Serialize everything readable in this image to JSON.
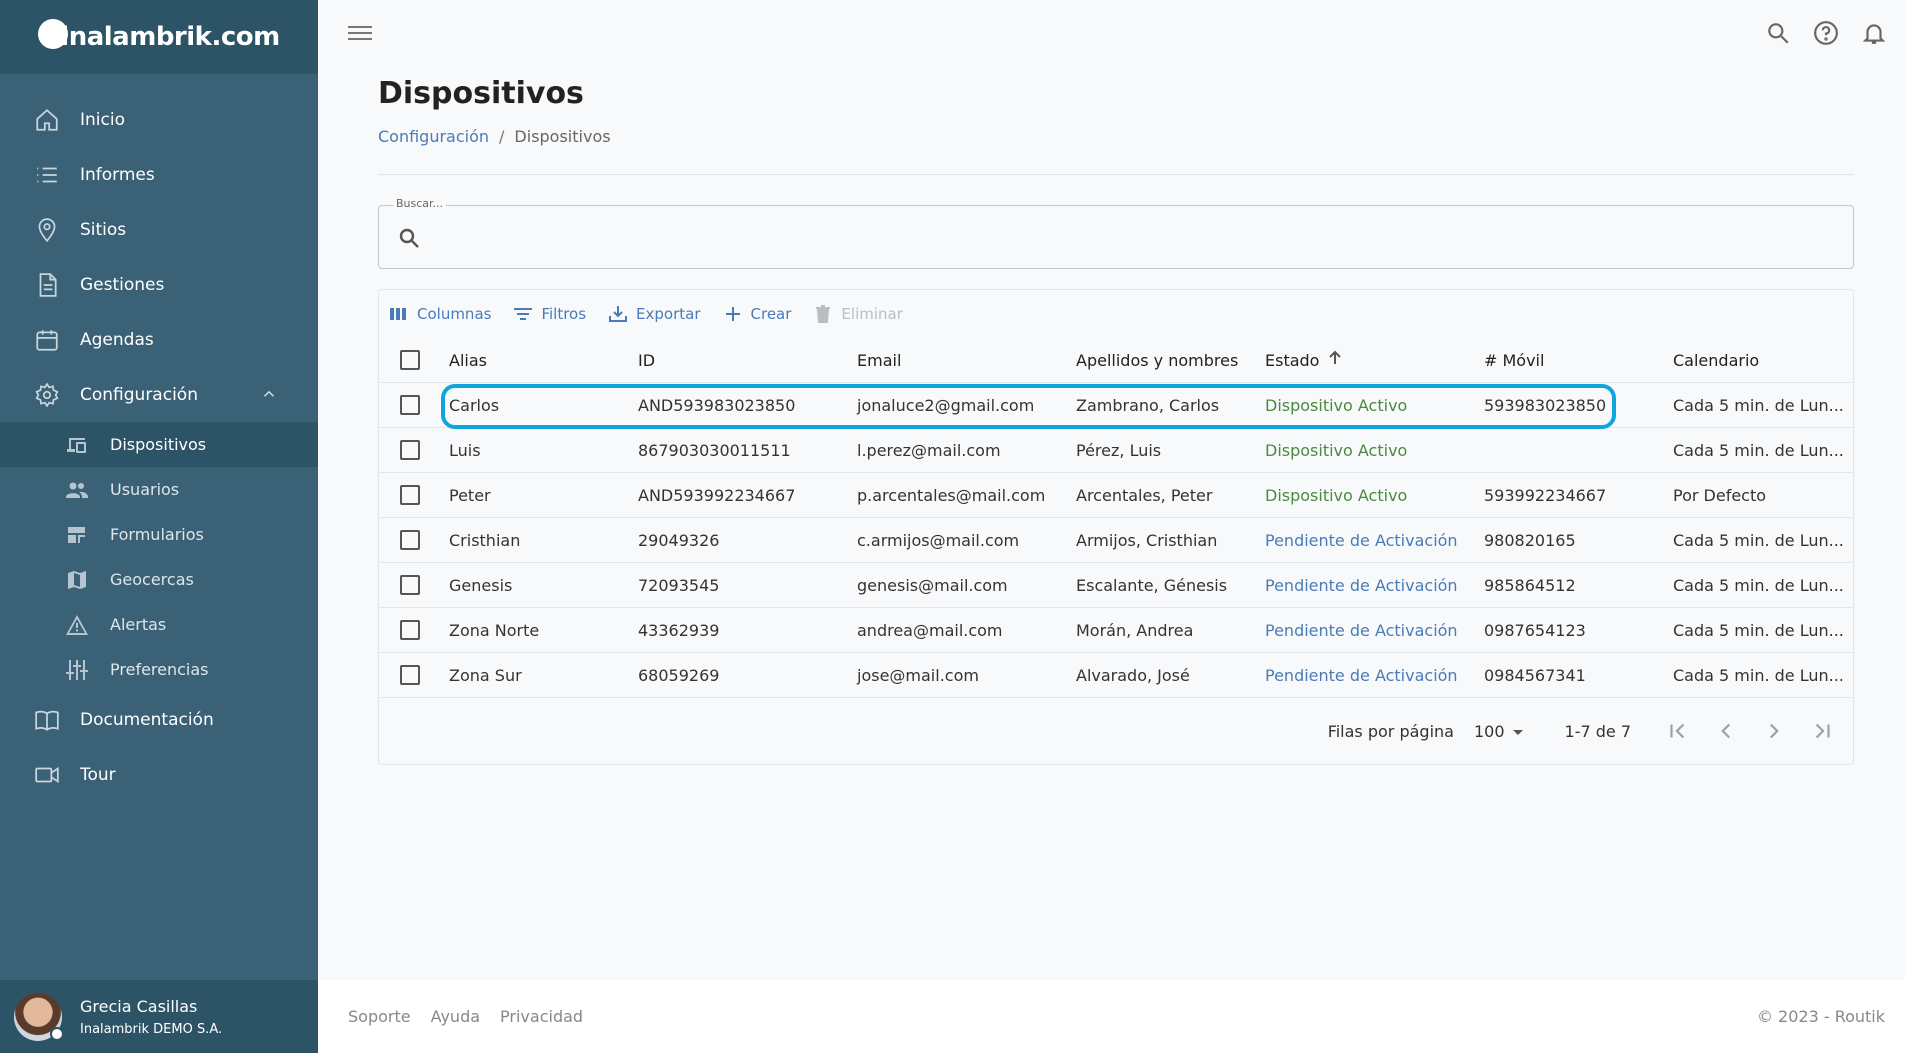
{
  "brand": {
    "logo_text": "inalambrik.com"
  },
  "sidebar": {
    "items": [
      {
        "label": "Inicio",
        "icon": "home-icon"
      },
      {
        "label": "Informes",
        "icon": "list-icon"
      },
      {
        "label": "Sitios",
        "icon": "map-pin-icon"
      },
      {
        "label": "Gestiones",
        "icon": "document-icon"
      },
      {
        "label": "Agendas",
        "icon": "calendar-icon"
      },
      {
        "label": "Configuración",
        "icon": "gear-icon"
      }
    ],
    "sub_items": [
      {
        "label": "Dispositivos",
        "icon": "devices-icon"
      },
      {
        "label": "Usuarios",
        "icon": "users-icon"
      },
      {
        "label": "Formularios",
        "icon": "forms-icon"
      },
      {
        "label": "Geocercas",
        "icon": "map-icon"
      },
      {
        "label": "Alertas",
        "icon": "warning-icon"
      },
      {
        "label": "Preferencias",
        "icon": "sliders-icon"
      }
    ],
    "bottom_items": [
      {
        "label": "Documentación",
        "icon": "book-icon"
      },
      {
        "label": "Tour",
        "icon": "video-icon"
      }
    ],
    "user": {
      "name": "Grecia Casillas",
      "org": "Inalambrik DEMO S.A."
    }
  },
  "page": {
    "title": "Dispositivos",
    "breadcrumb": {
      "parent": "Configuración",
      "separator": "/",
      "current": "Dispositivos"
    }
  },
  "search": {
    "label": "Buscar..."
  },
  "toolbar": {
    "columns": "Columnas",
    "filters": "Filtros",
    "export": "Exportar",
    "create": "Crear",
    "delete": "Eliminar"
  },
  "table": {
    "headers": [
      "Alias",
      "ID",
      "Email",
      "Apellidos y nombres",
      "Estado",
      "# Móvil",
      "Calendario"
    ],
    "rows": [
      {
        "alias": "Carlos",
        "id": "AND593983023850",
        "email": "jonaluce2@gmail.com",
        "name": "Zambrano, Carlos",
        "estado": "Dispositivo Activo",
        "movil": "593983023850",
        "cal": "Cada 5 min. de Lun..."
      },
      {
        "alias": "Luis",
        "id": "867903030011511",
        "email": "l.perez@mail.com",
        "name": "Pérez, Luis",
        "estado": "Dispositivo Activo",
        "movil": "",
        "cal": "Cada 5 min. de Lun..."
      },
      {
        "alias": "Peter",
        "id": "AND593992234667",
        "email": "p.arcentales@mail.com",
        "name": "Arcentales, Peter",
        "estado": "Dispositivo Activo",
        "movil": "593992234667",
        "cal": "Por Defecto"
      },
      {
        "alias": "Cristhian",
        "id": "29049326",
        "email": "c.armijos@mail.com",
        "name": "Armijos, Cristhian",
        "estado": "Pendiente de Activación",
        "movil": "980820165",
        "cal": "Cada 5 min. de Lun..."
      },
      {
        "alias": "Genesis",
        "id": "72093545",
        "email": "genesis@mail.com",
        "name": "Escalante, Génesis",
        "estado": "Pendiente de Activación",
        "movil": "985864512",
        "cal": "Cada 5 min. de Lun..."
      },
      {
        "alias": "Zona Norte",
        "id": "43362939",
        "email": "andrea@mail.com",
        "name": "Morán, Andrea",
        "estado": "Pendiente de Activación",
        "movil": "0987654123",
        "cal": "Cada 5 min. de Lun..."
      },
      {
        "alias": "Zona Sur",
        "id": "68059269",
        "email": "jose@mail.com",
        "name": "Alvarado, José",
        "estado": "Pendiente de Activación",
        "movil": "0984567341",
        "cal": "Cada 5 min. de Lun..."
      }
    ]
  },
  "pagination": {
    "label": "Filas por página",
    "rows_per_page": "100",
    "range": "1-7 de 7"
  },
  "footer": {
    "links": [
      "Soporte",
      "Ayuda",
      "Privacidad"
    ],
    "copyright": "© 2023 - Routik"
  },
  "colors": {
    "sidebar": "#3b6176",
    "sidebar_dark": "#2d5366",
    "link": "#4a7bb7",
    "active_status": "#4b8a3e",
    "highlight": "#0ea5df"
  }
}
